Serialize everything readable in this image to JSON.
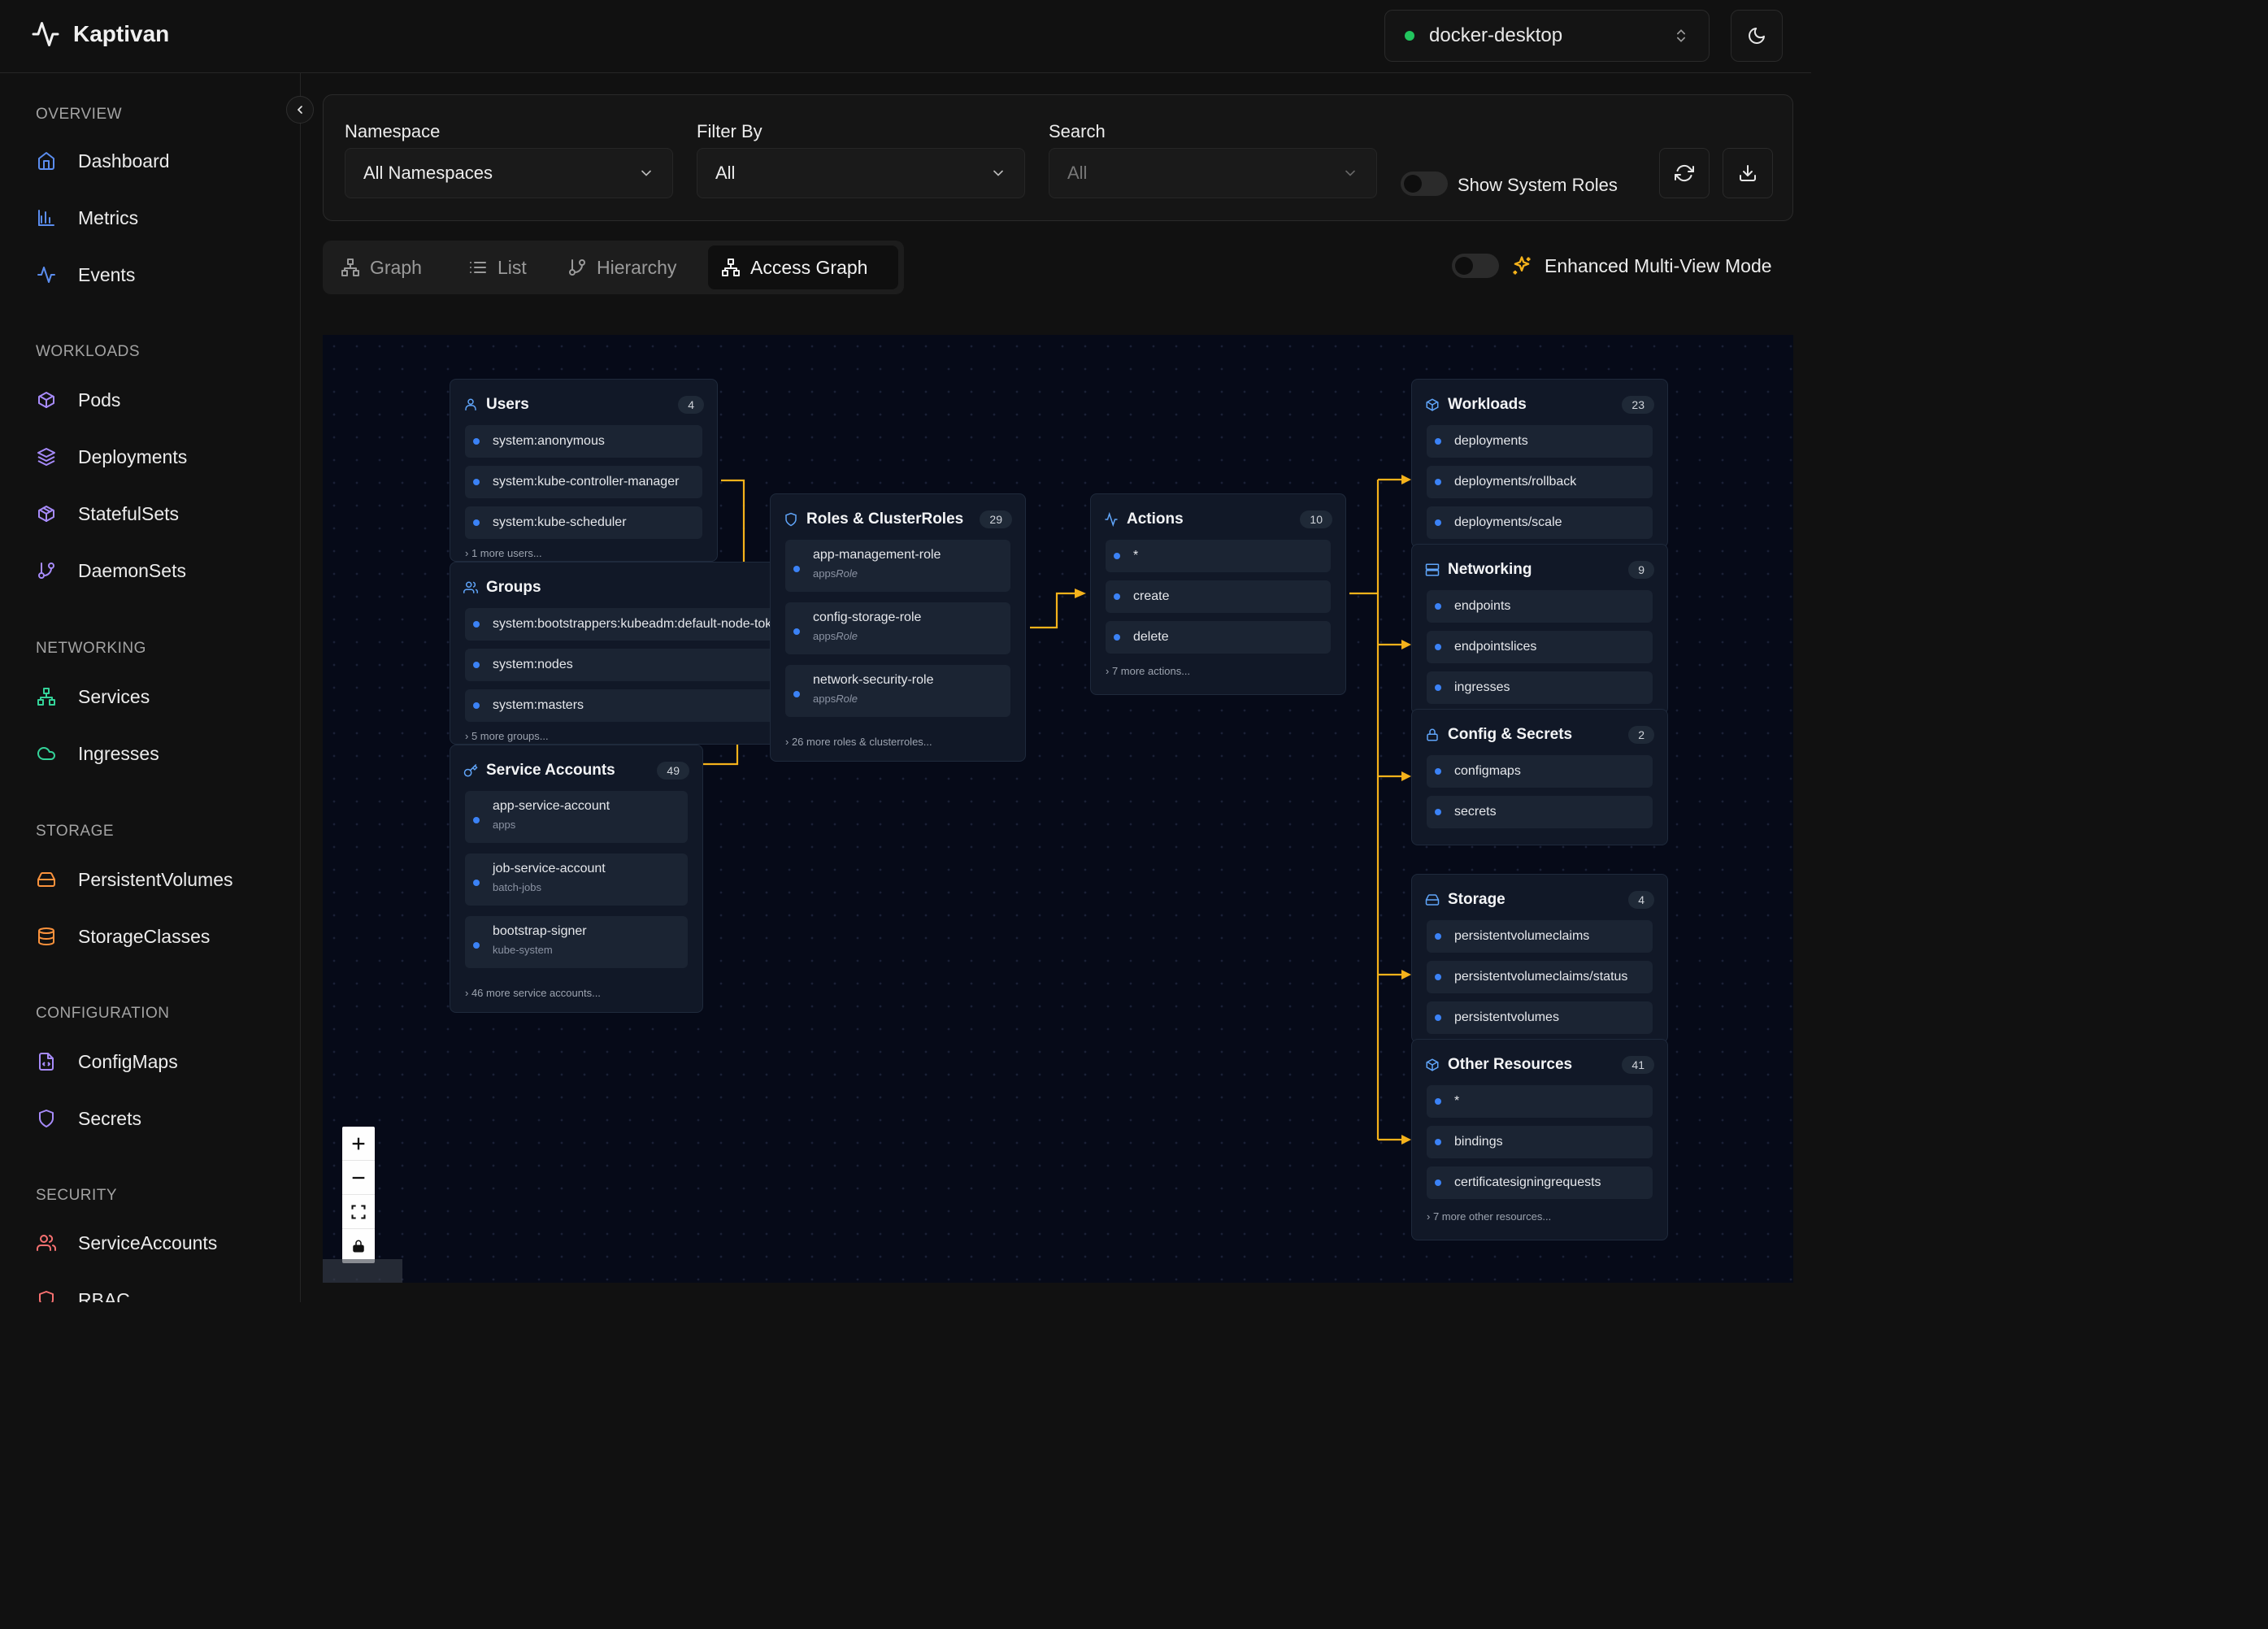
{
  "app": {
    "name": "Kaptivan"
  },
  "context": {
    "label": "docker-desktop",
    "status_color": "#22c55e"
  },
  "sidebar": {
    "sections": [
      {
        "title": "OVERVIEW",
        "items": [
          {
            "label": "Dashboard",
            "icon": "home-icon"
          },
          {
            "label": "Metrics",
            "icon": "bar-chart-icon"
          },
          {
            "label": "Events",
            "icon": "activity-icon"
          }
        ]
      },
      {
        "title": "WORKLOADS",
        "items": [
          {
            "label": "Pods",
            "icon": "box-icon"
          },
          {
            "label": "Deployments",
            "icon": "layers-icon"
          },
          {
            "label": "StatefulSets",
            "icon": "package-icon"
          },
          {
            "label": "DaemonSets",
            "icon": "git-branch-icon"
          }
        ]
      },
      {
        "title": "NETWORKING",
        "items": [
          {
            "label": "Services",
            "icon": "network-icon"
          },
          {
            "label": "Ingresses",
            "icon": "cloud-icon"
          }
        ]
      },
      {
        "title": "STORAGE",
        "items": [
          {
            "label": "PersistentVolumes",
            "icon": "hard-drive-icon"
          },
          {
            "label": "StorageClasses",
            "icon": "database-icon"
          }
        ]
      },
      {
        "title": "CONFIGURATION",
        "items": [
          {
            "label": "ConfigMaps",
            "icon": "file-code-icon"
          },
          {
            "label": "Secrets",
            "icon": "shield-icon"
          }
        ]
      },
      {
        "title": "SECURITY",
        "items": [
          {
            "label": "ServiceAccounts",
            "icon": "users-icon"
          },
          {
            "label": "RBAC",
            "icon": "shield-icon"
          }
        ]
      }
    ]
  },
  "filters": {
    "namespace": {
      "label": "Namespace",
      "value": "All Namespaces"
    },
    "filter_by": {
      "label": "Filter By",
      "value": "All"
    },
    "search": {
      "label": "Search",
      "placeholder": "All"
    },
    "show_system_roles": {
      "label": "Show System Roles",
      "enabled": false
    }
  },
  "tabs": [
    {
      "label": "Graph"
    },
    {
      "label": "List"
    },
    {
      "label": "Hierarchy"
    },
    {
      "label": "Access Graph",
      "active": true
    }
  ],
  "enhanced_mode": {
    "label": "Enhanced Multi-View Mode",
    "enabled": false
  },
  "graph": {
    "users": {
      "title": "Users",
      "count": "4",
      "items": [
        "system:anonymous",
        "system:kube-controller-manager",
        "system:kube-scheduler"
      ],
      "more": "1 more users..."
    },
    "groups": {
      "title": "Groups",
      "items": [
        "system:bootstrappers:kubeadm:default-node-token",
        "system:nodes",
        "system:masters"
      ],
      "more": "5 more groups..."
    },
    "service_accounts": {
      "title": "Service Accounts",
      "count": "49",
      "items": [
        {
          "name": "app-service-account",
          "ns": "apps"
        },
        {
          "name": "job-service-account",
          "ns": "batch-jobs"
        },
        {
          "name": "bootstrap-signer",
          "ns": "kube-system"
        }
      ],
      "more": "46 more service accounts..."
    },
    "roles": {
      "title": "Roles & ClusterRoles",
      "count": "29",
      "items": [
        {
          "name": "app-management-role",
          "ns": "apps",
          "kind": "Role"
        },
        {
          "name": "config-storage-role",
          "ns": "apps",
          "kind": "Role"
        },
        {
          "name": "network-security-role",
          "ns": "apps",
          "kind": "Role"
        }
      ],
      "more": "26 more roles & clusterroles..."
    },
    "actions": {
      "title": "Actions",
      "count": "10",
      "items": [
        "*",
        "create",
        "delete"
      ],
      "more": "7 more actions..."
    },
    "workloads": {
      "title": "Workloads",
      "count": "23",
      "items": [
        "deployments",
        "deployments/rollback",
        "deployments/scale"
      ]
    },
    "networking": {
      "title": "Networking",
      "count": "9",
      "items": [
        "endpoints",
        "endpointslices",
        "ingresses"
      ]
    },
    "config_secrets": {
      "title": "Config & Secrets",
      "count": "2",
      "items": [
        "configmaps",
        "secrets"
      ]
    },
    "storage": {
      "title": "Storage",
      "count": "4",
      "items": [
        "persistentvolumeclaims",
        "persistentvolumeclaims/status",
        "persistentvolumes"
      ]
    },
    "other": {
      "title": "Other Resources",
      "count": "41",
      "items": [
        "*",
        "bindings",
        "certificatesigningrequests"
      ],
      "more": "7 more other resources..."
    },
    "edge_color": "#f5b21b"
  }
}
